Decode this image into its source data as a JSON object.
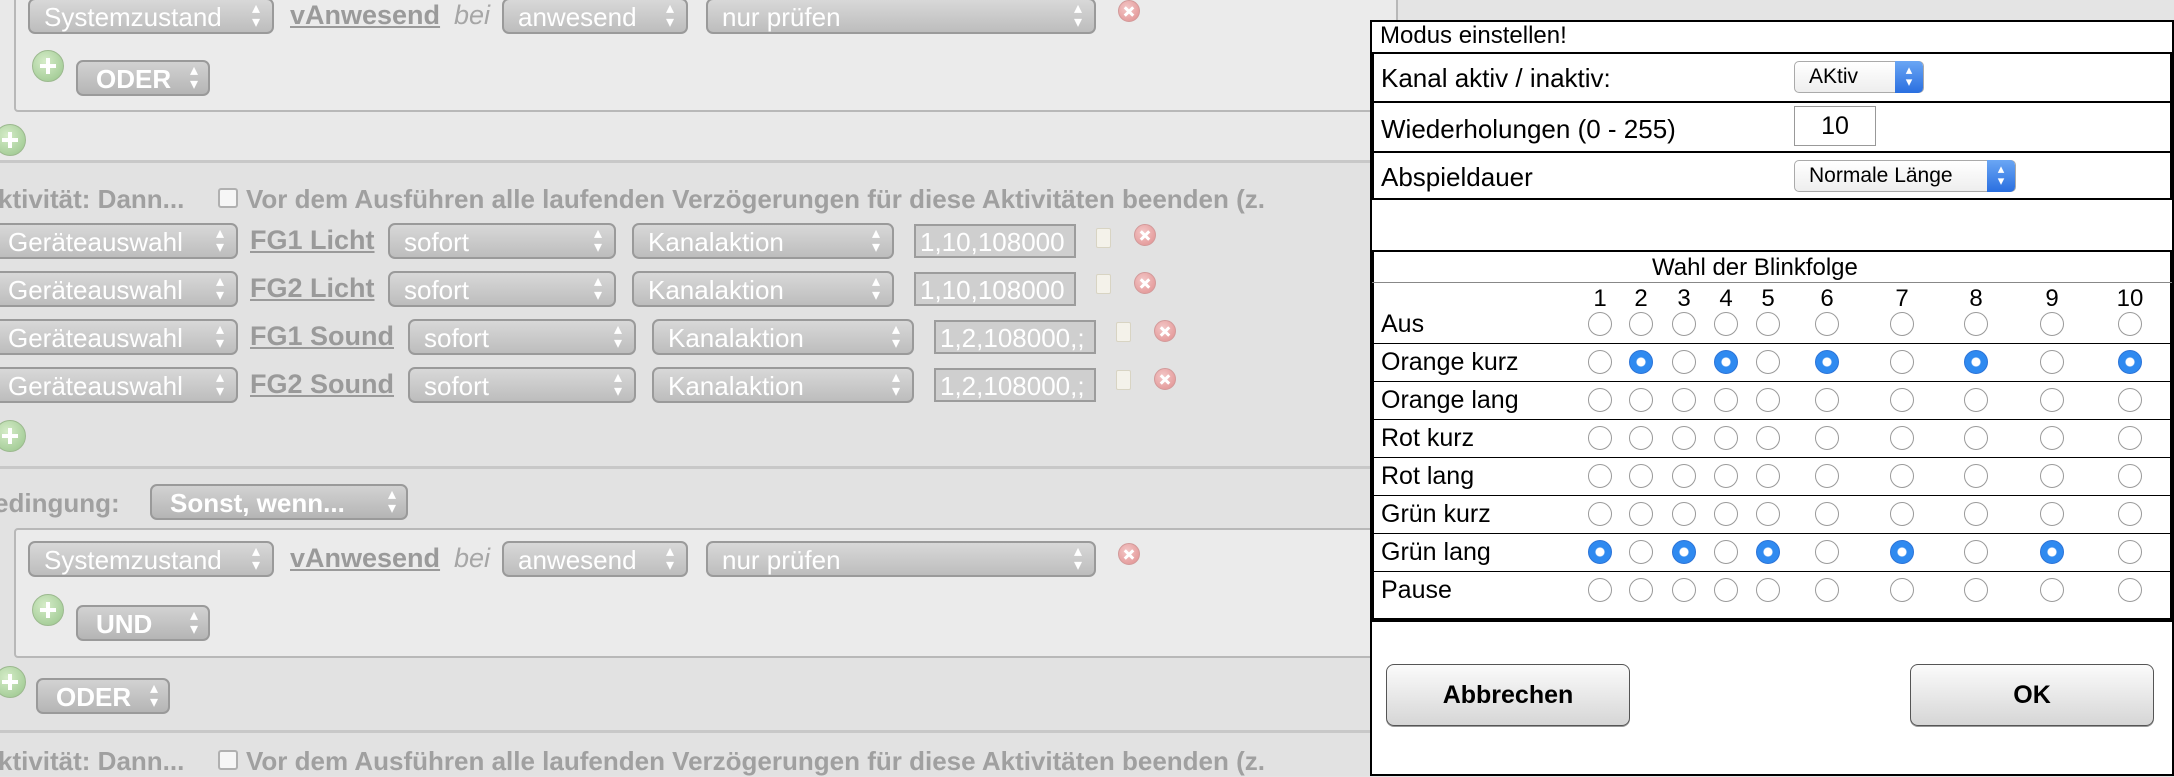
{
  "rule_top": {
    "row1": {
      "device": "Systemzustand",
      "name": "vAnwesend",
      "bei": "bei",
      "state": "anwesend",
      "mode": "nur prüfen"
    },
    "logic": "ODER"
  },
  "activity1": {
    "header": "ktivität: Dann...",
    "checkbox_label": "Vor dem Ausführen alle laufenden Verzögerungen für diese Aktivitäten beenden (z.",
    "rows": [
      {
        "device": "Geräteauswahl",
        "name": "FG1 Licht",
        "timing": "sofort",
        "action": "Kanalaktion",
        "value": "1,10,108000"
      },
      {
        "device": "Geräteauswahl",
        "name": "FG2 Licht",
        "timing": "sofort",
        "action": "Kanalaktion",
        "value": "1,10,108000"
      },
      {
        "device": "Geräteauswahl",
        "name": "FG1 Sound",
        "timing": "sofort",
        "action": "Kanalaktion",
        "value": "1,2,108000,;"
      },
      {
        "device": "Geräteauswahl",
        "name": "FG2 Sound",
        "timing": "sofort",
        "action": "Kanalaktion",
        "value": "1,2,108000,;"
      }
    ]
  },
  "condition": {
    "label": "edingung:",
    "type": "Sonst, wenn...",
    "row1": {
      "device": "Systemzustand",
      "name": "vAnwesend",
      "bei": "bei",
      "state": "anwesend",
      "mode": "nur prüfen"
    },
    "inner_logic": "UND",
    "outer_logic": "ODER"
  },
  "activity2": {
    "header": "ktivität: Dann...",
    "checkbox_label": "Vor dem Ausführen alle laufenden Verzögerungen für diese Aktivitäten beenden (z."
  },
  "dialog": {
    "title": "Modus einstellen!",
    "kanal_label": "Kanal aktiv / inaktiv:",
    "kanal_value": "AKtiv",
    "wiederholungen_label": "Wiederholungen (0 - 255)",
    "wiederholungen_value": "10",
    "abspieldauer_label": "Abspieldauer",
    "abspieldauer_value": "Normale Länge",
    "table_title": "Wahl der Blinkfolge",
    "columns": [
      "1",
      "2",
      "3",
      "4",
      "5",
      "6",
      "7",
      "8",
      "9",
      "10"
    ],
    "rows": [
      {
        "label": "Aus",
        "selected": 0
      },
      {
        "label": "Orange kurz",
        "selected": [
          2,
          4,
          6,
          8,
          10
        ]
      },
      {
        "label": "Orange lang",
        "selected": 0
      },
      {
        "label": "Rot kurz",
        "selected": 0
      },
      {
        "label": "Rot lang",
        "selected": 0
      },
      {
        "label": "Grün kurz",
        "selected": 0
      },
      {
        "label": "Grün lang",
        "selected": [
          1,
          3,
          5,
          7,
          9
        ]
      },
      {
        "label": "Pause",
        "selected": 0
      }
    ],
    "cancel_label": "Abbrechen",
    "ok_label": "OK"
  }
}
